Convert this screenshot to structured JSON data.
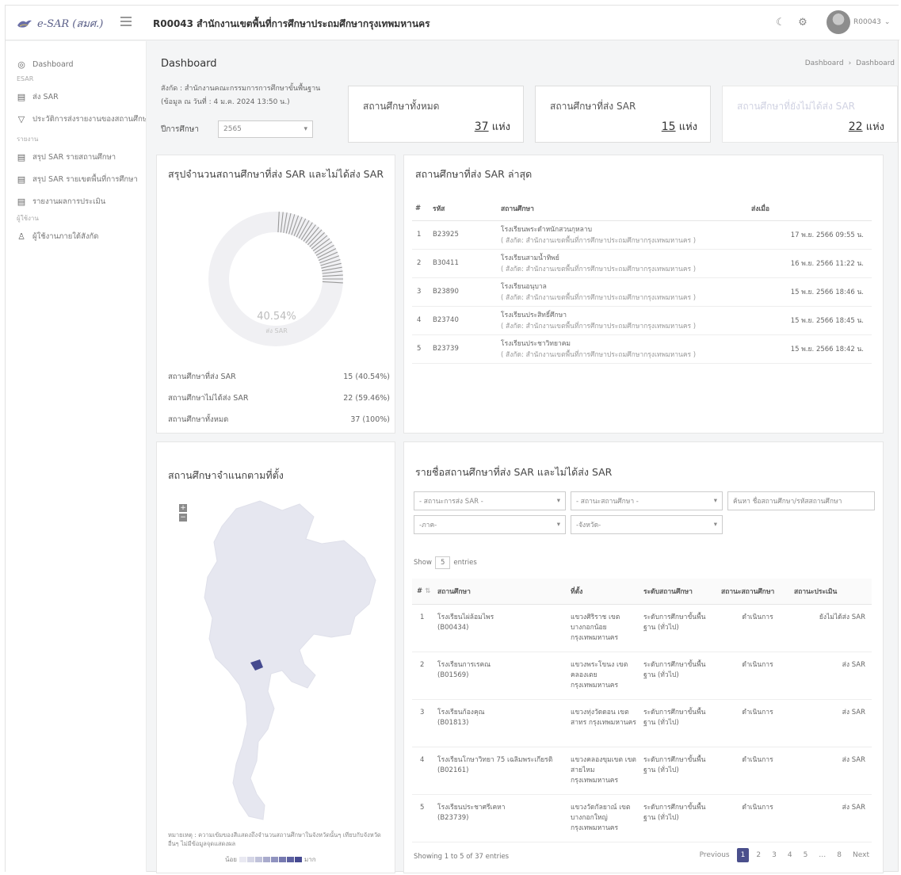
{
  "app": {
    "logo_text": "e-SAR (สมศ.)",
    "org_title": "R00043 สำนักงานเขตพื้นที่การศึกษาประถมศึกษากรุงเทพมหานคร",
    "user_name": "R00043"
  },
  "sidebar": {
    "items": [
      {
        "label": "Dashboard",
        "icon": "dashboard-icon"
      },
      {
        "heading": "ESAR"
      },
      {
        "label": "ส่ง SAR",
        "icon": "document-icon"
      },
      {
        "label": "ประวัติการส่งรายงานของสถานศึกษา",
        "icon": "filter-icon"
      },
      {
        "heading": "รายงาน"
      },
      {
        "label": "สรุป SAR รายสถานศึกษา",
        "icon": "document-icon"
      },
      {
        "label": "สรุป SAR รายเขตพื้นที่การศึกษา",
        "icon": "document-icon"
      },
      {
        "label": "รายงานผลการประเมิน",
        "icon": "document-icon"
      },
      {
        "heading": "ผู้ใช้งาน"
      },
      {
        "label": "ผู้ใช้งานภายใต้สังกัด",
        "icon": "users-icon"
      }
    ]
  },
  "page": {
    "title": "Dashboard",
    "breadcrumb": [
      "Dashboard",
      "Dashboard"
    ],
    "affiliation": "สังกัด : สำนักงานคณะกรรมการการศึกษาขั้นพื้นฐาน",
    "data_as_of": "(ข้อมูล ณ วันที่ : 4 ม.ค. 2024 13:50 น.)",
    "year_label": "ปีการศึกษา",
    "year_value": "2565"
  },
  "stats": [
    {
      "label": "สถานศึกษาทั้งหมด",
      "value": "37",
      "unit": "แห่ง"
    },
    {
      "label": "สถานศึกษาที่ส่ง SAR",
      "value": "15",
      "unit": "แห่ง"
    },
    {
      "label": "สถานศึกษาที่ยังไม่ได้ส่ง SAR",
      "value": "22",
      "unit": "แห่ง"
    }
  ],
  "summary": {
    "title": "สรุปจำนวนสถานศึกษาที่ส่ง SAR และไม่ได้ส่ง SAR",
    "percent_label": "40.54%",
    "center_caption": "ส่ง SAR",
    "rows": [
      {
        "label": "สถานศึกษาที่ส่ง SAR",
        "value": "15  (40.54%)"
      },
      {
        "label": "สถานศึกษาไม่ได้ส่ง SAR",
        "value": "22  (59.46%)"
      },
      {
        "label": "สถานศึกษาทั้งหมด",
        "value": "37  (100%)"
      }
    ]
  },
  "chart_data": {
    "type": "pie",
    "categories": [
      "สถานศึกษาที่ส่ง SAR",
      "สถานศึกษาไม่ได้ส่ง SAR"
    ],
    "values": [
      15,
      22
    ],
    "title": "สรุปจำนวนสถานศึกษาที่ส่ง SAR และไม่ได้ส่ง SAR",
    "annotation": "40.54%"
  },
  "latest": {
    "title": "สถานศึกษาที่ส่ง SAR ล่าสุด",
    "headers": [
      "#",
      "รหัส",
      "สถานศึกษา",
      "ส่งเมื่อ"
    ],
    "rows": [
      {
        "no": "1",
        "code": "B23925",
        "name": "โรงเรียนพระดำหนักสวนกุหลาบ",
        "org": "( สังกัด: สำนักงานเขตพื้นที่การศึกษาประถมศึกษากรุงเทพมหานคร )",
        "date": "17 พ.ย. 2566 09:55 น."
      },
      {
        "no": "2",
        "code": "B30411",
        "name": "โรงเรียนสามน้ำทิพย์",
        "org": "( สังกัด: สำนักงานเขตพื้นที่การศึกษาประถมศึกษากรุงเทพมหานคร )",
        "date": "16 พ.ย. 2566 11:22 น."
      },
      {
        "no": "3",
        "code": "B23890",
        "name": "โรงเรียนอนุบาล",
        "org": "( สังกัด: สำนักงานเขตพื้นที่การศึกษาประถมศึกษากรุงเทพมหานคร )",
        "date": "15 พ.ย. 2566 18:46 น."
      },
      {
        "no": "4",
        "code": "B23740",
        "name": "โรงเรียนประสิทธิ์ศึกษา",
        "org": "( สังกัด: สำนักงานเขตพื้นที่การศึกษาประถมศึกษากรุงเทพมหานคร )",
        "date": "15 พ.ย. 2566 18:45 น."
      },
      {
        "no": "5",
        "code": "B23739",
        "name": "โรงเรียนประชาวิทยาคม",
        "org": "( สังกัด: สำนักงานเขตพื้นที่การศึกษาประถมศึกษากรุงเทพมหานคร )",
        "date": "15 พ.ย. 2566 18:42 น."
      }
    ]
  },
  "map": {
    "title": "สถานศึกษาจำแนกตามที่ตั้ง",
    "zoom_in": "+",
    "zoom_out": "−",
    "note": "หมายเหตุ : ความเข้มของสีแสดงถึงจำนวนสถานศึกษาในจังหวัดนั้นๆ เทียบกับจังหวัดอื่นๆ ไม่มีข้อมูลจุดแสดงผล",
    "legend_low": "น้อย",
    "legend_high": "มาก",
    "legend_colors": [
      "#e9e9f2",
      "#d5d6e6",
      "#c0c2da",
      "#a9abcd",
      "#9093bf",
      "#7679b0",
      "#5d61a1",
      "#464a91"
    ]
  },
  "schools": {
    "title": "รายชื่อสถานศึกษาที่ส่ง SAR และไม่ได้ส่ง SAR",
    "filter_sar": "- สถานะการส่ง SAR -",
    "filter_level": "- สถานะสถานศึกษา -",
    "search_placeholder": "ค้นหา ชื่อสถานศึกษา/รหัสสถานศึกษา",
    "filter_type": "-ภาค-",
    "filter_province": "-จังหวัด-",
    "show_label": "Show",
    "show_value": "5",
    "entries_label": "entries",
    "headers": [
      "#",
      "สถานศึกษา",
      "ที่ตั้ง",
      "ระดับสถานศึกษา",
      "สถานะสถานศึกษา",
      "สถานะประเมิน"
    ],
    "rows": [
      {
        "no": "1",
        "name": "โรงเรียนไผ่ล้อมไพร",
        "code": "(B00434)",
        "location": "แขวงศิริราช เขตบางกอกน้อย กรุงเทพมหานคร",
        "level": "ระดับการศึกษาขั้นพื้นฐาน (ทั่วไป)",
        "status": "ดำเนินการ",
        "eval": "ยังไม่ได้ส่ง SAR"
      },
      {
        "no": "2",
        "name": "โรงเรียนการเรคณ",
        "code": "(B01569)",
        "location": "แขวงพระโขนง เขตคลองเตย กรุงเทพมหานคร",
        "level": "ระดับการศึกษาขั้นพื้นฐาน (ทั่วไป)",
        "status": "ดำเนินการ",
        "eval": "ส่ง SAR"
      },
      {
        "no": "3",
        "name": "โรงเรียนก้องคุณ",
        "code": "(B01813)",
        "location": "แขวงทุ่งวัดดอน เขตสาทร กรุงเทพมหานคร",
        "level": "ระดับการศึกษาขั้นพื้นฐาน (ทั่วไป)",
        "status": "ดำเนินการ",
        "eval": "ส่ง SAR"
      },
      {
        "no": "4",
        "name": "โรงเรียนโกษาวิทยา 75 เฉลิมพระเกียรติ",
        "code": "(B02161)",
        "location": "แขวงคลองขุมเขต เขตสายไหม กรุงเทพมหานคร",
        "level": "ระดับการศึกษาขั้นพื้นฐาน (ทั่วไป)",
        "status": "ดำเนินการ",
        "eval": "ส่ง SAR"
      },
      {
        "no": "5",
        "name": "โรงเรียนประชาศรีเคหา",
        "code": "(B23739)",
        "location": "แขวงวัดกัลยาณ์ เขตบางกอกใหญ่ กรุงเทพมหานคร",
        "level": "ระดับการศึกษาขั้นพื้นฐาน (ทั่วไป)",
        "status": "ดำเนินการ",
        "eval": "ส่ง SAR"
      }
    ],
    "footer": "Showing 1 to 5 of 37 entries",
    "pager": [
      "Previous",
      "1",
      "2",
      "3",
      "4",
      "5",
      "…",
      "8",
      "Next"
    ]
  }
}
